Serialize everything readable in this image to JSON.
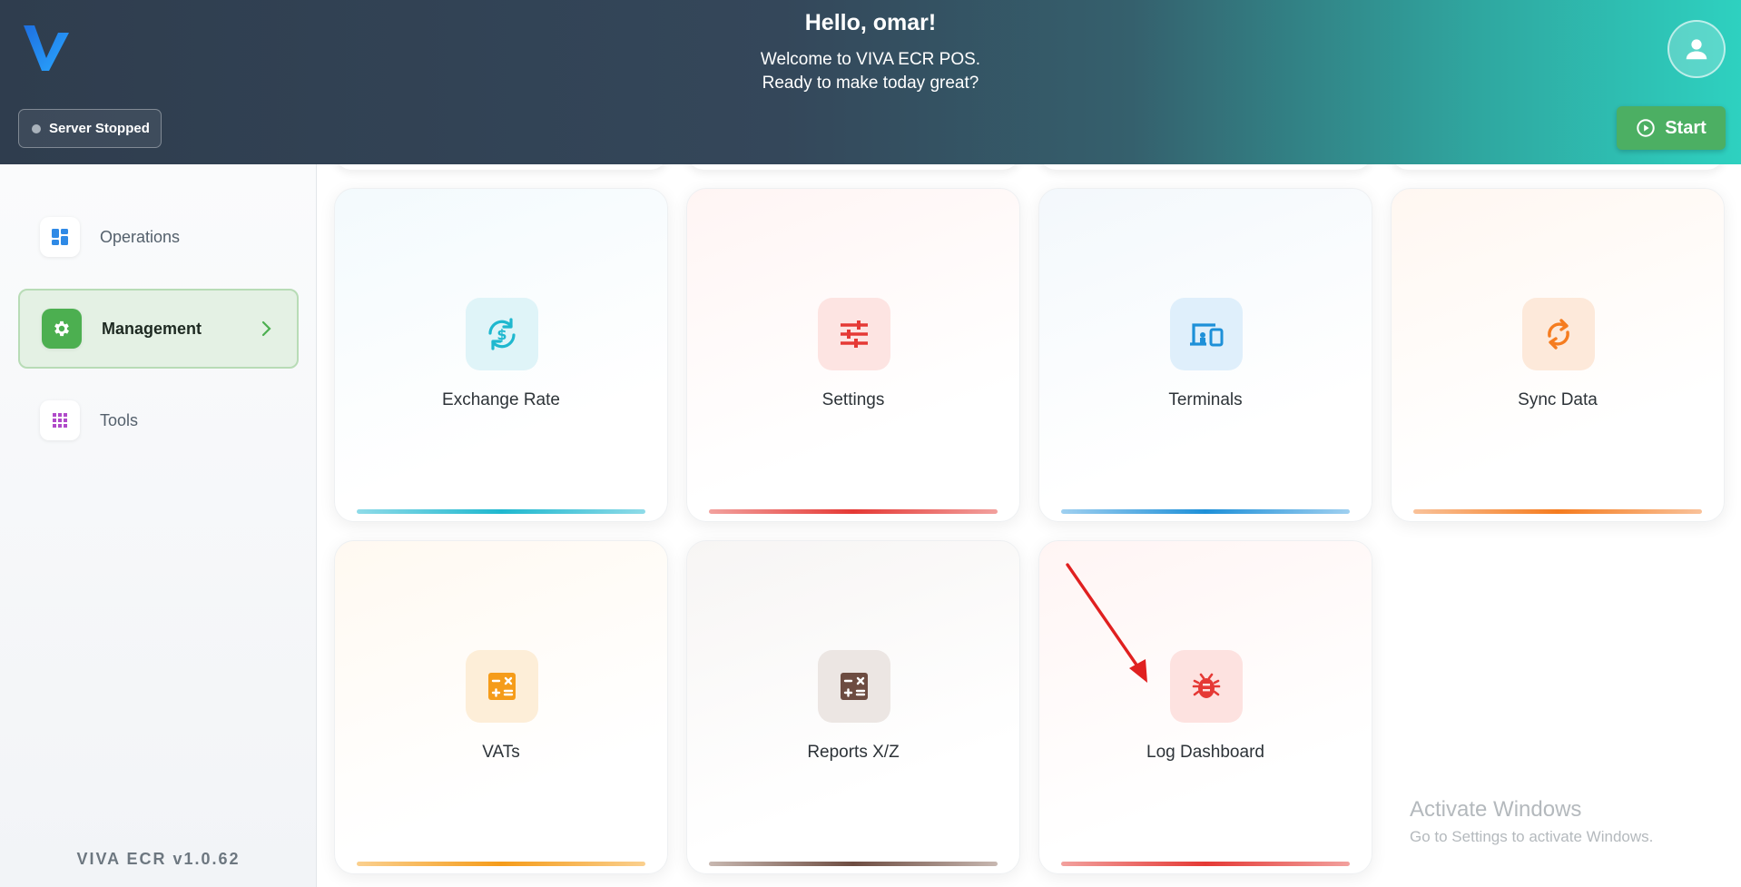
{
  "header": {
    "greeting": "Hello, omar!",
    "welcome_line1": "Welcome to VIVA ECR POS.",
    "welcome_line2": "Ready to make today great?",
    "server_status": "Server Stopped",
    "start_label": "Start",
    "logo_icon": "viva-logo",
    "avatar_icon": "user-icon"
  },
  "sidebar": {
    "items": [
      {
        "label": "Operations",
        "icon": "dashboard-icon",
        "active": false
      },
      {
        "label": "Management",
        "icon": "gear-icon",
        "active": true
      },
      {
        "label": "Tools",
        "icon": "apps-grid-icon",
        "active": false
      }
    ],
    "version": "VIVA ECR  v1.0.62"
  },
  "cards": [
    {
      "label": "Exchange Rate",
      "icon": "currency-exchange-icon",
      "accent": "#1fb8cf"
    },
    {
      "label": "Settings",
      "icon": "sliders-icon",
      "accent": "#e53935"
    },
    {
      "label": "Terminals",
      "icon": "devices-icon",
      "accent": "#1e90d8"
    },
    {
      "label": "Sync Data",
      "icon": "sync-icon",
      "accent": "#f57c1f"
    },
    {
      "label": "VATs",
      "icon": "calculator-icon",
      "accent": "#f59c1a"
    },
    {
      "label": "Reports X/Z",
      "icon": "calculator-icon",
      "accent": "#6d4c41"
    },
    {
      "label": "Log Dashboard",
      "icon": "bug-icon",
      "accent": "#e53935"
    }
  ],
  "watermark": {
    "title": "Activate Windows",
    "subtitle": "Go to Settings to activate Windows."
  }
}
